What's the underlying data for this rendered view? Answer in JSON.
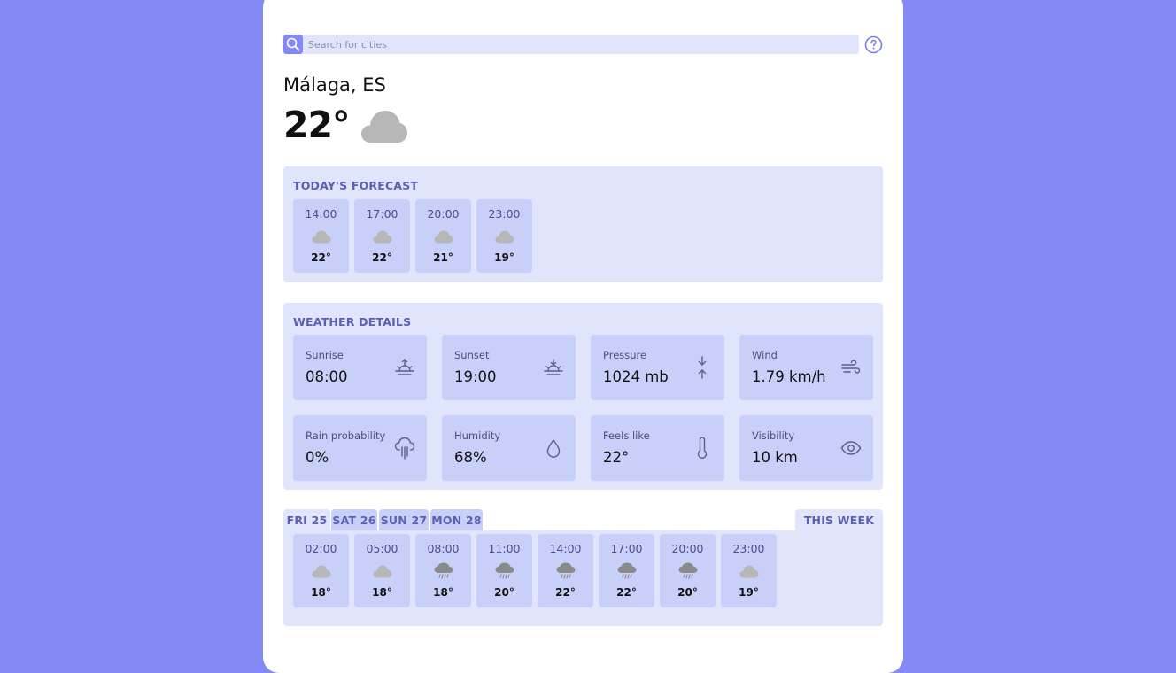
{
  "search": {
    "placeholder": "Search for cities"
  },
  "location": {
    "city": "Málaga, ES"
  },
  "current": {
    "temperature": "22°",
    "condition_icon": "cloud-icon"
  },
  "today_forecast": {
    "title": "TODAY'S FORECAST",
    "hours": [
      {
        "time": "14:00",
        "icon": "cloud-icon",
        "temp": "22°"
      },
      {
        "time": "17:00",
        "icon": "cloud-icon",
        "temp": "22°"
      },
      {
        "time": "20:00",
        "icon": "cloud-icon",
        "temp": "21°"
      },
      {
        "time": "23:00",
        "icon": "cloud-icon",
        "temp": "19°"
      }
    ]
  },
  "weather_details": {
    "title": "WEATHER DETAILS",
    "items": [
      {
        "label": "Sunrise",
        "value": "08:00",
        "icon": "sunrise-icon"
      },
      {
        "label": "Sunset",
        "value": "19:00",
        "icon": "sunset-icon"
      },
      {
        "label": "Pressure",
        "value": "1024 mb",
        "icon": "pressure-arrows-icon"
      },
      {
        "label": "Wind",
        "value": "1.79 km/h",
        "icon": "wind-icon"
      },
      {
        "label": "Rain probability",
        "value": "0%",
        "icon": "rain-cloud-icon"
      },
      {
        "label": "Humidity",
        "value": "68%",
        "icon": "droplet-icon"
      },
      {
        "label": "Feels like",
        "value": "22°",
        "icon": "thermometer-icon"
      },
      {
        "label": "Visibility",
        "value": "10 km",
        "icon": "eye-icon"
      }
    ]
  },
  "week": {
    "tabs": [
      {
        "label": "FRI 25",
        "active": true
      },
      {
        "label": "SAT 26",
        "active": false
      },
      {
        "label": "SUN 27",
        "active": false
      },
      {
        "label": "MON 28",
        "active": false
      }
    ],
    "this_week_label": "THIS WEEK",
    "hours": [
      {
        "time": "02:00",
        "icon": "cloud-icon",
        "temp": "18°"
      },
      {
        "time": "05:00",
        "icon": "cloud-icon",
        "temp": "18°"
      },
      {
        "time": "08:00",
        "icon": "rain-cloud-icon",
        "temp": "18°"
      },
      {
        "time": "11:00",
        "icon": "rain-cloud-icon",
        "temp": "20°"
      },
      {
        "time": "14:00",
        "icon": "rain-cloud-icon",
        "temp": "22°"
      },
      {
        "time": "17:00",
        "icon": "rain-cloud-icon",
        "temp": "22°"
      },
      {
        "time": "20:00",
        "icon": "rain-cloud-icon",
        "temp": "20°"
      },
      {
        "time": "23:00",
        "icon": "cloud-icon",
        "temp": "19°"
      }
    ]
  },
  "colors": {
    "background": "#8489f8",
    "panel": "#e0e5fc",
    "tile": "#c8d0fa",
    "accent_text": "#5b5fb4",
    "cloud": "#b7b7b7",
    "rain_cloud": "#8a8a8a"
  }
}
